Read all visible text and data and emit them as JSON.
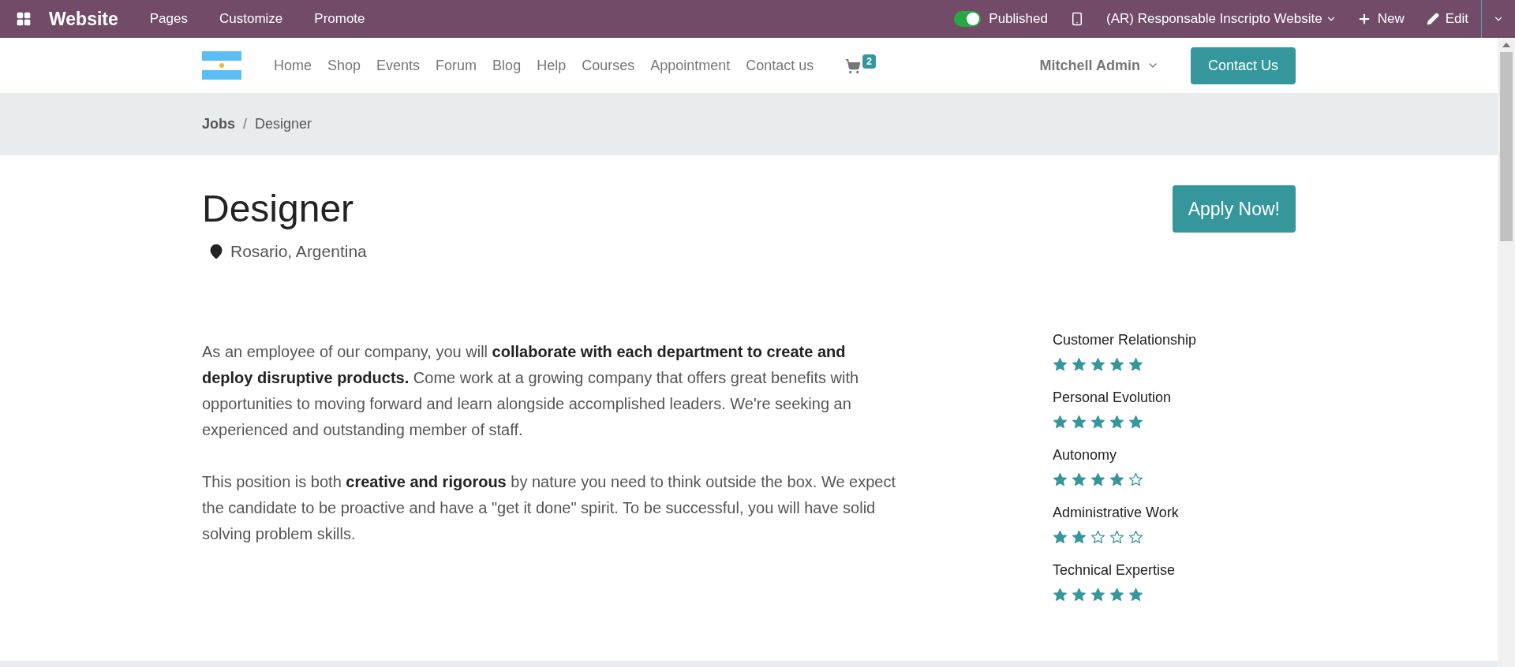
{
  "admin_bar": {
    "app": "Website",
    "menu": [
      "Pages",
      "Customize",
      "Promote"
    ],
    "published": {
      "label": "Published",
      "on": true
    },
    "website": "(AR) Responsable Inscripto Website",
    "new": "New",
    "edit": "Edit"
  },
  "nav": {
    "links": [
      "Home",
      "Shop",
      "Events",
      "Forum",
      "Blog",
      "Help",
      "Courses",
      "Appointment",
      "Contact us"
    ],
    "cart_count": "2",
    "user": "Mitchell Admin",
    "cta": "Contact Us"
  },
  "breadcrumb": [
    "Jobs",
    "/",
    "Designer"
  ],
  "job": {
    "title": "Designer",
    "location": "Rosario, Argentina",
    "apply": "Apply Now!",
    "paragraphs": [
      "As an employee of our company, you will **collaborate with each department to create and deploy disruptive products.** Come work at a growing company that offers great benefits with opportunities to moving forward and learn alongside accomplished leaders. We're seeking an experienced and outstanding member of staff.",
      "This position is both **creative and rigorous** by nature you need to think outside the box. We expect the candidate to be proactive and have a \"get it done\" spirit. To be successful, you will have solid solving problem skills."
    ],
    "ratings": [
      {
        "label": "Customer Relationship",
        "stars": 5
      },
      {
        "label": "Personal Evolution",
        "stars": 5
      },
      {
        "label": "Autonomy",
        "stars": 4
      },
      {
        "label": "Administrative Work",
        "stars": 2
      },
      {
        "label": "Technical Expertise",
        "stars": 5
      }
    ]
  }
}
